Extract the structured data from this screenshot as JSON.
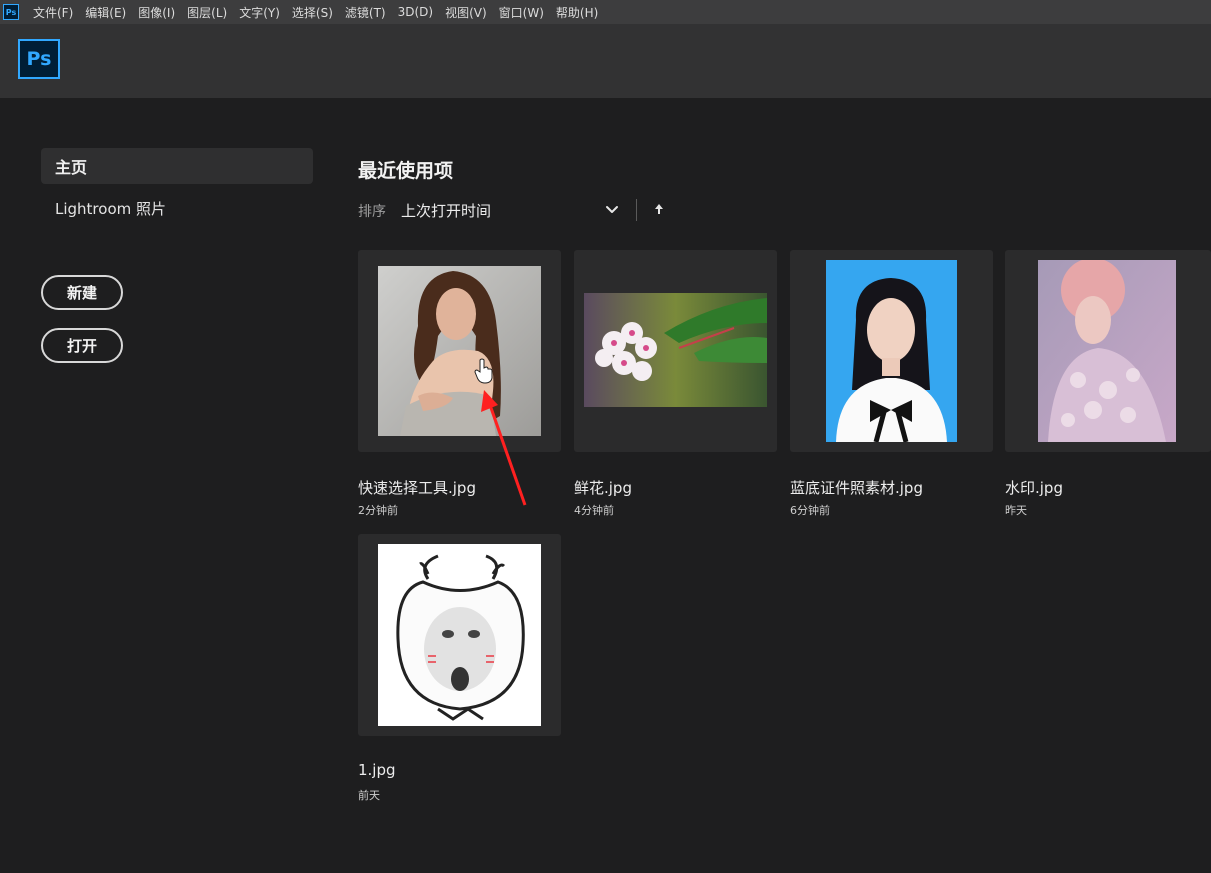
{
  "menubar": {
    "app_icon": "ps-icon",
    "items": [
      "文件(F)",
      "编辑(E)",
      "图像(I)",
      "图层(L)",
      "文字(Y)",
      "选择(S)",
      "滤镜(T)",
      "3D(D)",
      "视图(V)",
      "窗口(W)",
      "帮助(H)"
    ]
  },
  "header": {
    "logo_text": "Ps",
    "accent_color": "#31a8ff"
  },
  "sidebar": {
    "home_label": "主页",
    "lightroom_label": "Lightroom 照片",
    "new_label": "新建",
    "open_label": "打开"
  },
  "main": {
    "title": "最近使用项",
    "sort_label": "排序",
    "sort_value": "上次打开时间",
    "files": [
      {
        "name": "快速选择工具.jpg",
        "time": "2分钟前"
      },
      {
        "name": "鲜花.jpg",
        "time": "4分钟前"
      },
      {
        "name": "蓝底证件照素材.jpg",
        "time": "6分钟前"
      },
      {
        "name": "水印.jpg",
        "time": "昨天"
      },
      {
        "name": "1.jpg",
        "time": "前天"
      }
    ]
  }
}
